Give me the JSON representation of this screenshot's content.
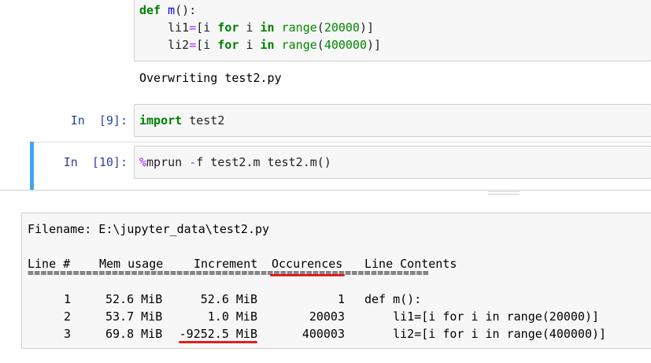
{
  "top_cell": {
    "line1": {
      "kw": "def",
      "name": "m",
      "rest": "():"
    },
    "line2": {
      "indent": "    ",
      "var": "li1",
      "eq": "=",
      "open": "[i ",
      "for": "for",
      "mid": " i ",
      "in": "in",
      "sp": " ",
      "range": "range",
      "lp": "(",
      "num": "20000",
      "rp": ")]"
    },
    "line3": {
      "indent": "    ",
      "var": "li2",
      "eq": "=",
      "open": "[i ",
      "for": "for",
      "mid": " i ",
      "in": "in",
      "sp": " ",
      "range": "range",
      "lp": "(",
      "num": "400000",
      "rp": ")]"
    }
  },
  "output_text": "Overwriting test2.py",
  "cell9": {
    "prompt": "In  [9]:",
    "kw": "import",
    "rest": " test2"
  },
  "cell10": {
    "prompt": "In  [10]:",
    "magic": "%",
    "cmd": "mprun ",
    "op": "-",
    "rest": "f test2.m test2.m()"
  },
  "pager": {
    "filename_line": "Filename: E:\\jupyter_data\\test2.py",
    "header": {
      "line": "Line #",
      "mem": "Mem usage",
      "inc": "Increment",
      "occ": "Occurences",
      "contents": "Line Contents"
    },
    "separator": "==============================================================",
    "rows": [
      {
        "line": "1",
        "mem": "52.6 MiB",
        "inc": "52.6 MiB",
        "occ": "1",
        "contents": "def m():"
      },
      {
        "line": "2",
        "mem": "53.7 MiB",
        "inc": "1.0 MiB",
        "occ": "20003",
        "contents": "    li1=[i for i in range(20000)]"
      },
      {
        "line": "3",
        "mem": "69.8 MiB",
        "inc": "-9252.5 MiB",
        "occ": "400003",
        "contents": "    li2=[i for i in range(400000)]"
      }
    ]
  },
  "colors": {
    "keyword": "#008000",
    "prompt": "#303f9f",
    "selected": "#42a5f5",
    "annotation": "#e02020"
  }
}
